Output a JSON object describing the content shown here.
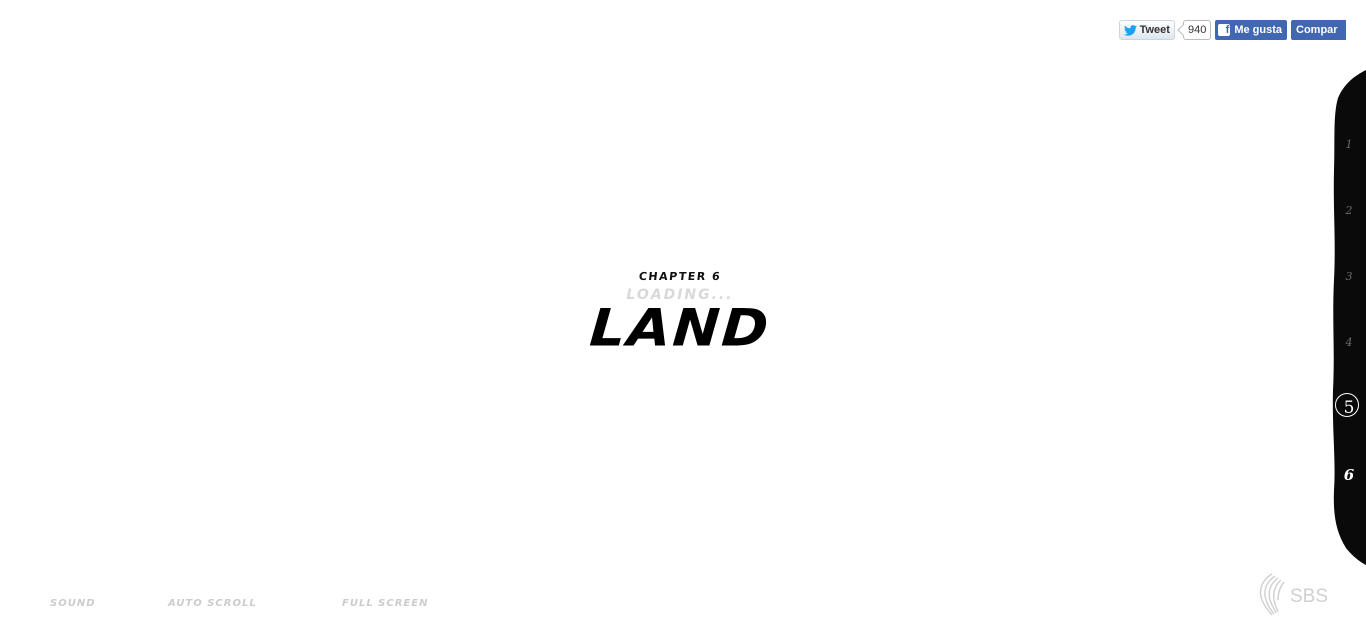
{
  "social": {
    "tweet_label": "Tweet",
    "tweet_count": "940",
    "like_label": "Me gusta",
    "share_label": "Compar"
  },
  "title": {
    "chapter": "CHAPTER 6",
    "loading": "LOADING...",
    "name": "LAND"
  },
  "chapter_nav": {
    "items": [
      "1",
      "2",
      "3",
      "4",
      "5",
      "6"
    ],
    "active_index": 4,
    "current_index": 5
  },
  "controls": {
    "sound": "SOUND",
    "auto_scroll": "AUTO SCROLL",
    "full_screen": "FULL SCREEN"
  },
  "logo": {
    "text": "SBS"
  },
  "colors": {
    "twitter_blue": "#1da1f2",
    "facebook_blue": "#4267b2",
    "ink": "#000000",
    "faint": "#cccccc"
  }
}
